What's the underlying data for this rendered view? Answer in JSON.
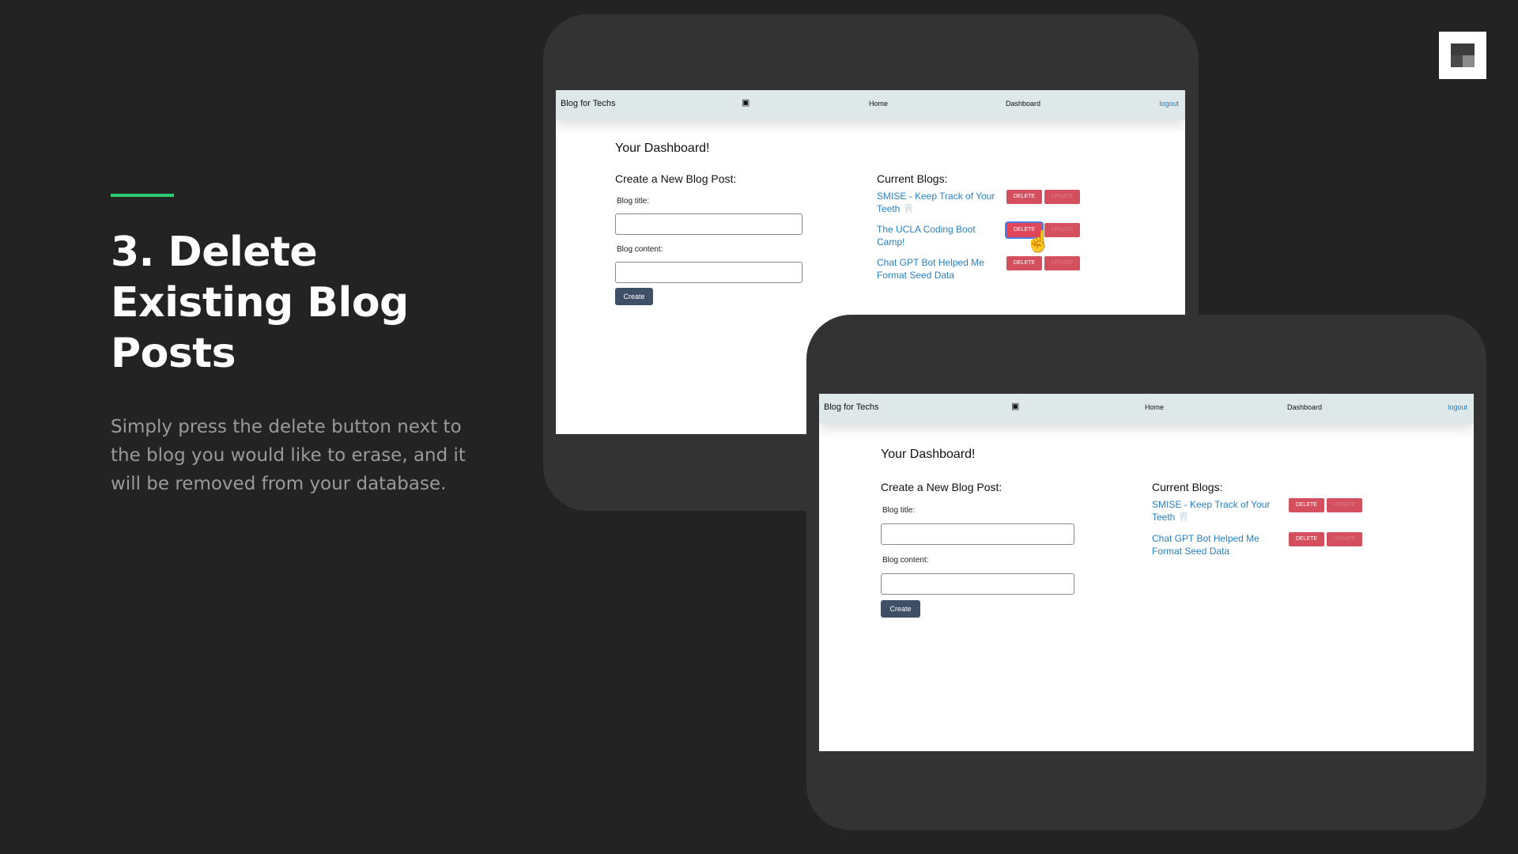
{
  "slide": {
    "heading": "3. Delete Existing Blog Posts",
    "description": "Simply press the delete button next to the blog you would like to erase, and it will be removed from your database.",
    "accent_color": "#2ecc71",
    "logo_icon": "square-grid-logo"
  },
  "app": {
    "brand": "Blog for Techs",
    "nav_icon": "chat-bubbles-icon",
    "nav_home": "Home",
    "nav_dashboard": "Dashboard",
    "nav_logout": "logout",
    "dashboard_title": "Your Dashboard!",
    "create_heading": "Create a New Blog Post:",
    "title_label": "Blog title:",
    "content_label": "Blog content:",
    "create_button": "Create",
    "current_blogs_heading": "Current Blogs:",
    "delete_label": "DELETE",
    "edit_label": "UPDATE"
  },
  "before": {
    "blogs": [
      {
        "title": "SMISE - Keep Track of Your Teeth",
        "emoji": "🦷"
      },
      {
        "title": "The UCLA Coding Boot Camp!",
        "emoji": ""
      },
      {
        "title": "Chat GPT Bot Helped Me Format Seed Data",
        "emoji": ""
      }
    ],
    "hovered_delete_index": 1
  },
  "after": {
    "blogs": [
      {
        "title": "SMISE - Keep Track of Your Teeth",
        "emoji": "🦷"
      },
      {
        "title": "Chat GPT Bot Helped Me Format Seed Data",
        "emoji": ""
      }
    ]
  }
}
